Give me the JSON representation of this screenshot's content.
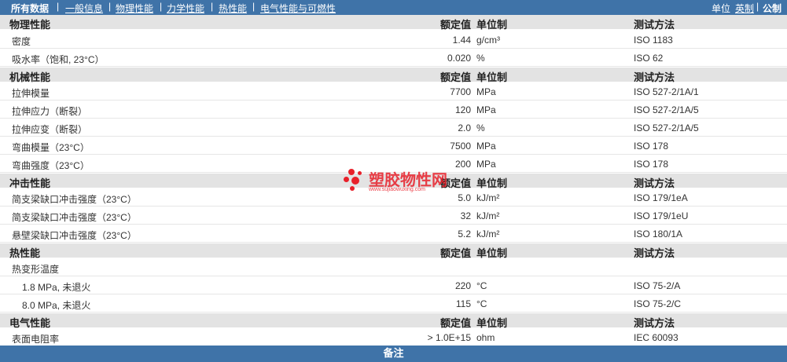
{
  "tabs": [
    {
      "label": "所有数据"
    },
    {
      "label": "一般信息"
    },
    {
      "label": "物理性能"
    },
    {
      "label": "力学性能"
    },
    {
      "label": "热性能"
    },
    {
      "label": "电气性能与可燃性"
    }
  ],
  "units": {
    "label": "单位",
    "imperial": "英制",
    "separator": "|",
    "metric": "公制"
  },
  "column_headers": {
    "value": "额定值",
    "unit": "单位制",
    "method": "测试方法"
  },
  "sections": [
    {
      "title": "物理性能",
      "rows": [
        {
          "property": "密度",
          "value": "1.44",
          "unit": "g/cm³",
          "method": "ISO 1183"
        },
        {
          "property": "吸水率（饱和, 23°C）",
          "value": "0.020",
          "unit": "%",
          "method": "ISO 62"
        }
      ]
    },
    {
      "title": "机械性能",
      "rows": [
        {
          "property": "拉伸模量",
          "value": "7700",
          "unit": "MPa",
          "method": "ISO 527-2/1A/1"
        },
        {
          "property": "拉伸应力（断裂）",
          "value": "120",
          "unit": "MPa",
          "method": "ISO 527-2/1A/5"
        },
        {
          "property": "拉伸应变（断裂）",
          "value": "2.0",
          "unit": "%",
          "method": "ISO 527-2/1A/5"
        },
        {
          "property": "弯曲模量（23°C）",
          "value": "7500",
          "unit": "MPa",
          "method": "ISO 178"
        },
        {
          "property": "弯曲强度（23°C）",
          "value": "200",
          "unit": "MPa",
          "method": "ISO 178"
        }
      ]
    },
    {
      "title": "冲击性能",
      "rows": [
        {
          "property": "简支梁缺口冲击强度（23°C）",
          "value": "5.0",
          "unit": "kJ/m²",
          "method": "ISO 179/1eA"
        },
        {
          "property": "简支梁缺口冲击强度（23°C）",
          "value": "32",
          "unit": "kJ/m²",
          "method": "ISO 179/1eU"
        },
        {
          "property": "悬壁梁缺口冲击强度（23°C）",
          "value": "5.2",
          "unit": "kJ/m²",
          "method": "ISO 180/1A"
        }
      ]
    },
    {
      "title": "热性能",
      "rows": [
        {
          "property": "热变形温度",
          "value": "",
          "unit": "",
          "method": ""
        },
        {
          "property": "1.8 MPa, 未退火",
          "value": "220",
          "unit": "°C",
          "method": "ISO 75-2/A",
          "indent": true
        },
        {
          "property": "8.0 MPa, 未退火",
          "value": "115",
          "unit": "°C",
          "method": "ISO 75-2/C",
          "indent": true
        }
      ]
    },
    {
      "title": "电气性能",
      "rows": [
        {
          "property": "表面电阻率",
          "value": "> 1.0E+15",
          "unit": "ohm",
          "method": "IEC 60093"
        }
      ]
    }
  ],
  "footer": {
    "label": "备注"
  },
  "watermark": {
    "title": "塑胶物性网",
    "url": "www.sujiaowuxing.com"
  },
  "colors": {
    "accent": "#3f73a8",
    "section_bg": "#e3e3e3",
    "watermark": "#e8202a"
  }
}
